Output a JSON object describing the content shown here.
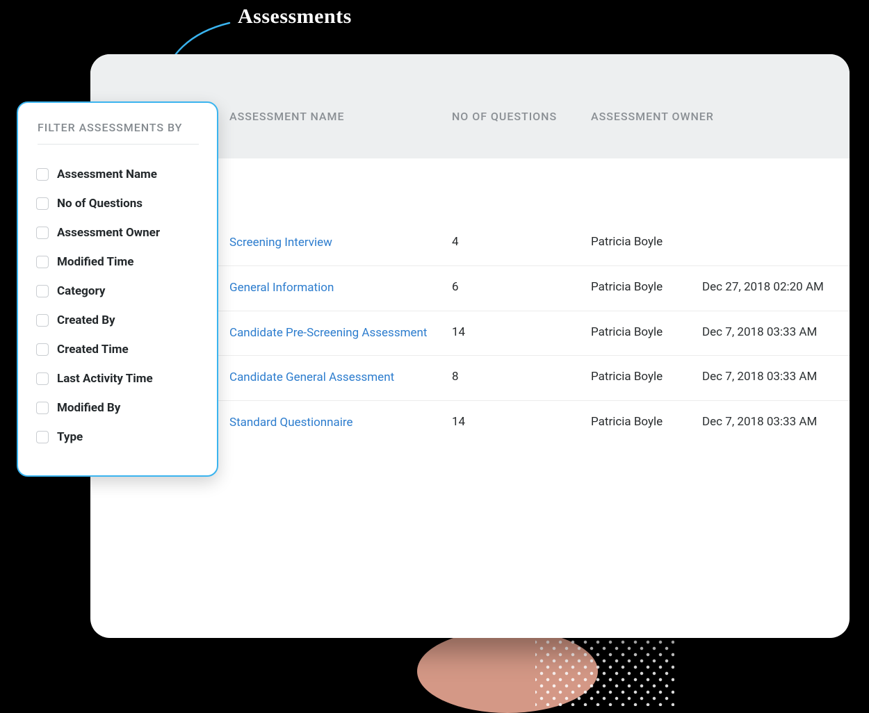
{
  "annotation": {
    "label": "Assessments"
  },
  "table": {
    "columns": {
      "name": "ASSESSMENT NAME",
      "questions": "NO OF QUESTIONS",
      "owner": "ASSESSMENT OWNER"
    },
    "rows": [
      {
        "name": "Screening Interview",
        "questions": "4",
        "owner": "Patricia Boyle",
        "modified": ""
      },
      {
        "name": "General Information",
        "questions": "6",
        "owner": "Patricia Boyle",
        "modified": "Dec 27, 2018 02:20 AM"
      },
      {
        "name": "Candidate Pre-Screening Assessment",
        "questions": "14",
        "owner": "Patricia Boyle",
        "modified": "Dec 7, 2018 03:33 AM"
      },
      {
        "name": "Candidate General Assessment",
        "questions": "8",
        "owner": "Patricia Boyle",
        "modified": "Dec 7, 2018 03:33 AM"
      },
      {
        "name": "Standard Questionnaire",
        "questions": "14",
        "owner": "Patricia Boyle",
        "modified": "Dec 7, 2018 03:33 AM"
      }
    ]
  },
  "filter": {
    "title": "FILTER ASSESSMENTS BY",
    "items": [
      {
        "label": "Assessment Name"
      },
      {
        "label": "No of Questions"
      },
      {
        "label": "Assessment Owner"
      },
      {
        "label": "Modified Time"
      },
      {
        "label": "Category"
      },
      {
        "label": "Created By"
      },
      {
        "label": "Created Time"
      },
      {
        "label": "Last Activity Time"
      },
      {
        "label": "Modified By"
      },
      {
        "label": "Type"
      }
    ]
  }
}
